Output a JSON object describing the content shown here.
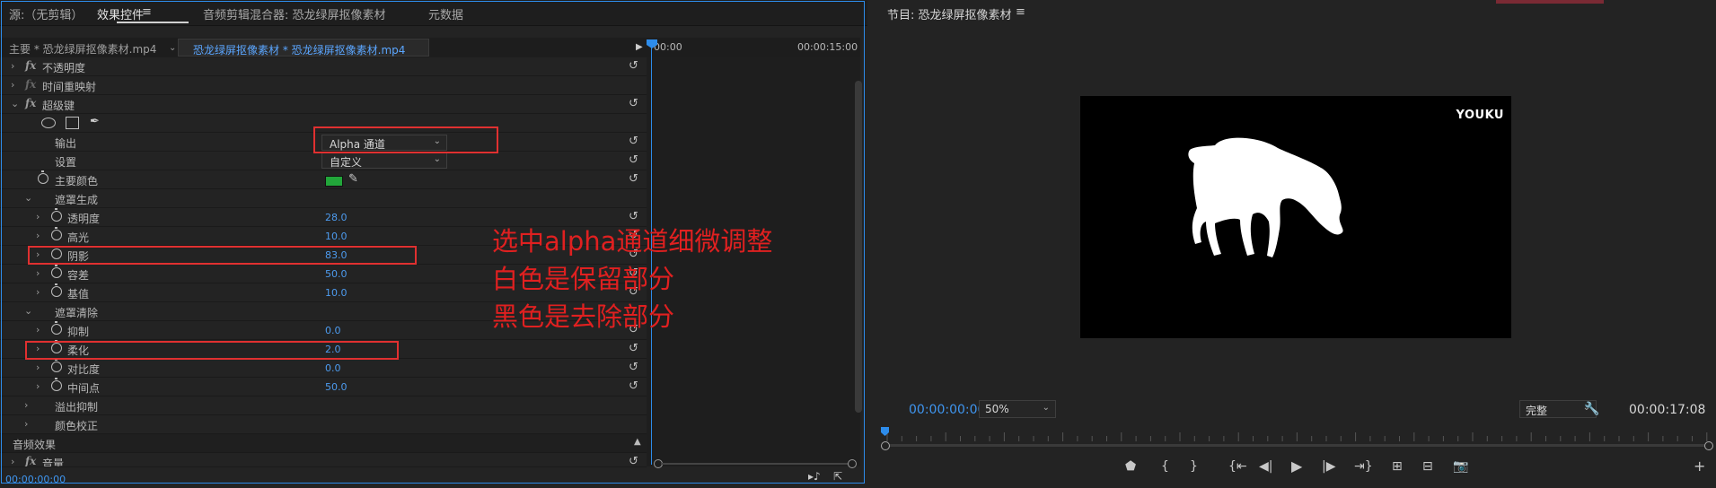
{
  "left_panel": {
    "tabs": [
      "源:（无剪辑）",
      "效果控件",
      "音频剪辑混合器: 恐龙绿屏抠像素材",
      "元数据"
    ],
    "active_tab_menu_icon": "hamburger-icon",
    "clip": {
      "master_label": "主要 * 恐龙绿屏抠像素材.mp4",
      "sequence_label": "恐龙绿屏抠像素材 * 恐龙绿屏抠像素材.mp4"
    },
    "timeline": {
      "start": "00:00",
      "end": "00:00:15:00"
    },
    "effects": {
      "opacity": "不透明度",
      "time_remap": "时间重映射",
      "ultra_key": "超级键",
      "output_label": "输出",
      "output_value": "Alpha 通道",
      "setting_label": "设置",
      "setting_value": "自定义",
      "key_color_label": "主要颜色",
      "key_color": "#22a63a",
      "matte_generation": "遮罩生成",
      "transparency_label": "透明度",
      "transparency_value": "28.0",
      "highlight_label": "高光",
      "highlight_value": "10.0",
      "shadow_label": "阴影",
      "shadow_value": "83.0",
      "tolerance_label": "容差",
      "tolerance_value": "50.0",
      "pedestal_label": "基值",
      "pedestal_value": "10.0",
      "matte_cleanup": "遮罩清除",
      "choke_label": "抑制",
      "choke_value": "0.0",
      "soften_label": "柔化",
      "soften_value": "2.0",
      "contrast_label": "对比度",
      "contrast_value": "0.0",
      "midpoint_label": "中间点",
      "midpoint_value": "50.0",
      "spill_suppression": "溢出抑制",
      "color_correction": "颜色校正",
      "audio_effects": "音频效果",
      "volume": "音量"
    },
    "annotation": [
      "选中alpha通道细微调整",
      "白色是保留部分",
      "黑色是去除部分"
    ],
    "current_time": "00:00:00:00"
  },
  "program_monitor": {
    "title": "节目: 恐龙绿屏抠像素材",
    "watermark": "YOUKU",
    "timecode": "00:00:00:00",
    "zoom": "50%",
    "quality": "完整",
    "duration": "00:00:17:08"
  },
  "colors": {
    "accent": "#2d8ceb",
    "annotation": "#e02020"
  }
}
